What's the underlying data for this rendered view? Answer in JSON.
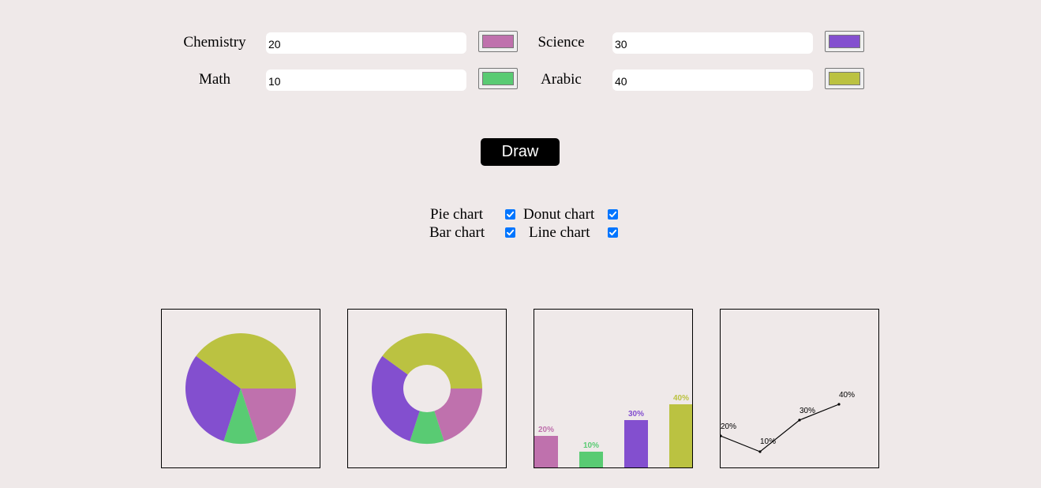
{
  "subjects": [
    {
      "label": "Chemistry",
      "value": "20",
      "color": "#bf71ad"
    },
    {
      "label": "Science",
      "value": "30",
      "color": "#834fcf"
    },
    {
      "label": "Math",
      "value": "10",
      "color": "#59cb73"
    },
    {
      "label": "Arabic",
      "value": "40",
      "color": "#bbc241"
    }
  ],
  "draw_button": {
    "label": "Draw"
  },
  "chart_toggles": [
    {
      "label": "Pie chart",
      "checked": true
    },
    {
      "label": "Donut chart",
      "checked": true
    },
    {
      "label": "Bar chart",
      "checked": true
    },
    {
      "label": "Line chart",
      "checked": true
    }
  ],
  "chart_data": [
    {
      "type": "pie",
      "categories": [
        "Chemistry",
        "Math",
        "Science",
        "Arabic"
      ],
      "values": [
        20,
        10,
        30,
        40
      ],
      "colors": [
        "#bf71ad",
        "#59cb73",
        "#834fcf",
        "#bbc241"
      ]
    },
    {
      "type": "donut",
      "categories": [
        "Chemistry",
        "Math",
        "Science",
        "Arabic"
      ],
      "values": [
        20,
        10,
        30,
        40
      ],
      "colors": [
        "#bf71ad",
        "#59cb73",
        "#834fcf",
        "#bbc241"
      ]
    },
    {
      "type": "bar",
      "categories": [
        "Chemistry",
        "Math",
        "Science",
        "Arabic"
      ],
      "values": [
        20,
        10,
        30,
        40
      ],
      "labels": [
        "20%",
        "10%",
        "30%",
        "40%"
      ],
      "colors": [
        "#bf71ad",
        "#59cb73",
        "#834fcf",
        "#bbc241"
      ],
      "ylim": [
        0,
        100
      ]
    },
    {
      "type": "line",
      "categories": [
        "Chemistry",
        "Math",
        "Science",
        "Arabic"
      ],
      "values": [
        20,
        10,
        30,
        40
      ],
      "labels": [
        "20%",
        "10%",
        "30%",
        "40%"
      ],
      "color": "#000000",
      "ylim": [
        0,
        100
      ]
    }
  ]
}
